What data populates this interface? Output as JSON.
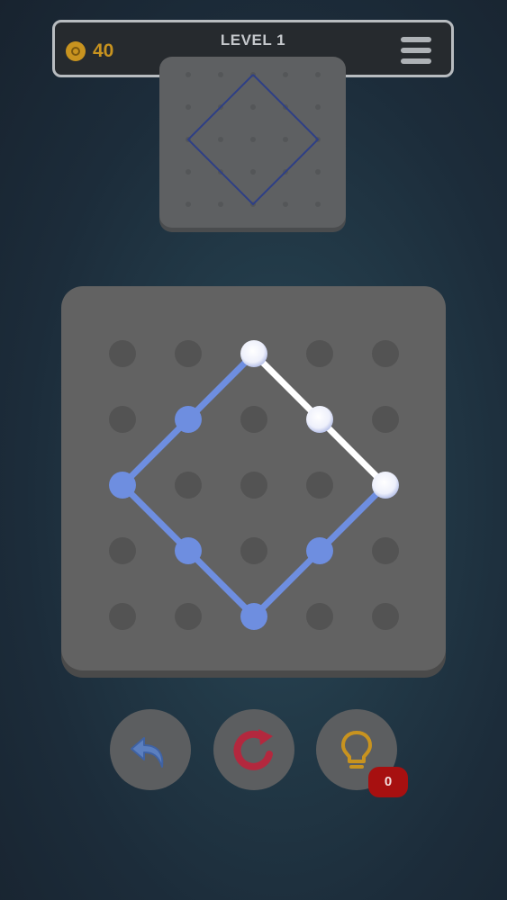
{
  "header": {
    "coins": "40",
    "level_title": "LEVEL 1"
  },
  "icons": {
    "coin": "coin-icon",
    "menu": "hamburger-menu-icon",
    "undo": "undo-arrow-icon",
    "restart": "restart-arrow-icon",
    "hint": "lightbulb-icon"
  },
  "colors": {
    "coin": "#c8931f",
    "drawn_line": "#6e8ee0",
    "active_line": "#ffffff",
    "target_line": "#2e3f86",
    "restart": "#b3283e",
    "hint": "#c8931f",
    "badge": "#a71010"
  },
  "grid": {
    "rows": 5,
    "cols": 5
  },
  "target_shape": {
    "points": [
      [
        2,
        0
      ],
      [
        4,
        2
      ],
      [
        2,
        4
      ],
      [
        0,
        2
      ],
      [
        2,
        0
      ]
    ]
  },
  "drawn_path": {
    "blue_points": [
      [
        4,
        2
      ],
      [
        3,
        3
      ],
      [
        2,
        4
      ],
      [
        1,
        3
      ],
      [
        0,
        2
      ],
      [
        1,
        1
      ],
      [
        2,
        0
      ]
    ],
    "white_points": [
      [
        2,
        0
      ],
      [
        3,
        1
      ],
      [
        4,
        2
      ]
    ]
  },
  "hints": {
    "count": "0"
  }
}
